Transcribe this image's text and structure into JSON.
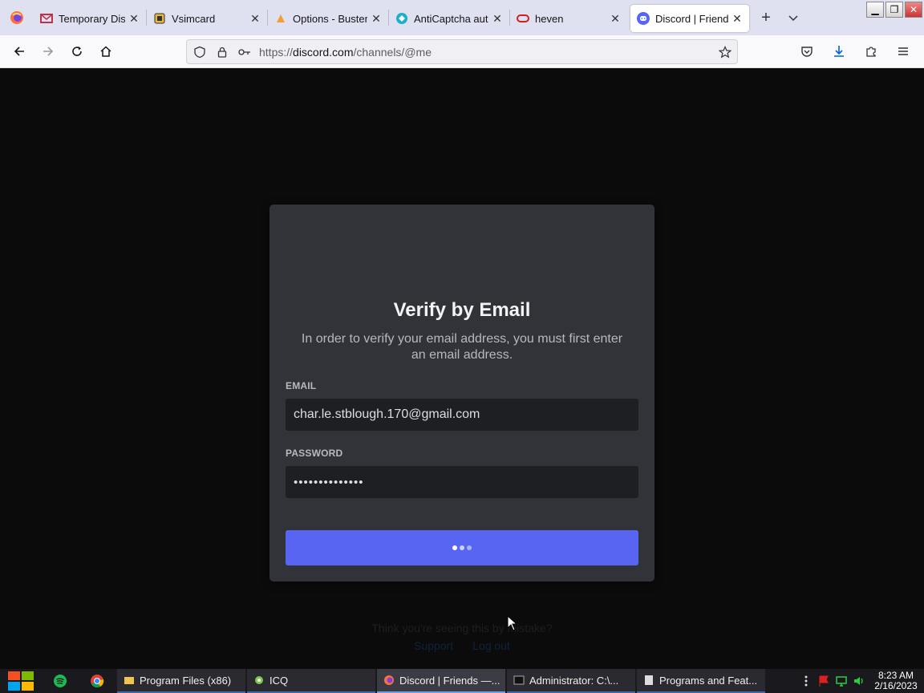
{
  "browser": {
    "tabs": [
      {
        "title": "Temporary Dispo",
        "icon": "mail-icon",
        "active": false
      },
      {
        "title": "Vsimcard",
        "icon": "sim-icon",
        "active": false
      },
      {
        "title": "Options - Buster",
        "icon": "buster-icon",
        "active": false
      },
      {
        "title": "AntiCaptcha auto",
        "icon": "anticaptcha-icon",
        "active": false
      },
      {
        "title": "heven",
        "icon": "link-icon",
        "active": false
      },
      {
        "title": "Discord | Friends",
        "icon": "discord-icon",
        "active": true
      }
    ],
    "url_scheme": "https://",
    "url_host": "discord.com",
    "url_path": "/channels/@me"
  },
  "modal": {
    "title": "Verify by Email",
    "description": "In order to verify your email address, you must first enter an email address.",
    "email_label": "EMAIL",
    "email_value": "char.le.stblough.170@gmail.com",
    "password_label": "PASSWORD",
    "password_value": "••••••••••••••",
    "submit_state": "loading"
  },
  "background": {
    "question": "Think you're seeing this by mistake?",
    "link_support": "Support",
    "link_logout": "Log out"
  },
  "taskbar": {
    "tasks": [
      {
        "label": "Program Files (x86)",
        "icon": "folder-icon",
        "active": false
      },
      {
        "label": "ICQ",
        "icon": "icq-icon",
        "active": false
      },
      {
        "label": "Discord | Friends —...",
        "icon": "firefox-icon",
        "active": true
      },
      {
        "label": "Administrator: C:\\...",
        "icon": "cmd-icon",
        "active": false
      },
      {
        "label": "Programs and Feat...",
        "icon": "programs-icon",
        "active": false
      }
    ],
    "time": "8:23 AM",
    "date": "2/16/2023"
  },
  "colors": {
    "accent": "#5865f2",
    "modal_bg": "#313338",
    "input_bg": "#1e1f22"
  }
}
